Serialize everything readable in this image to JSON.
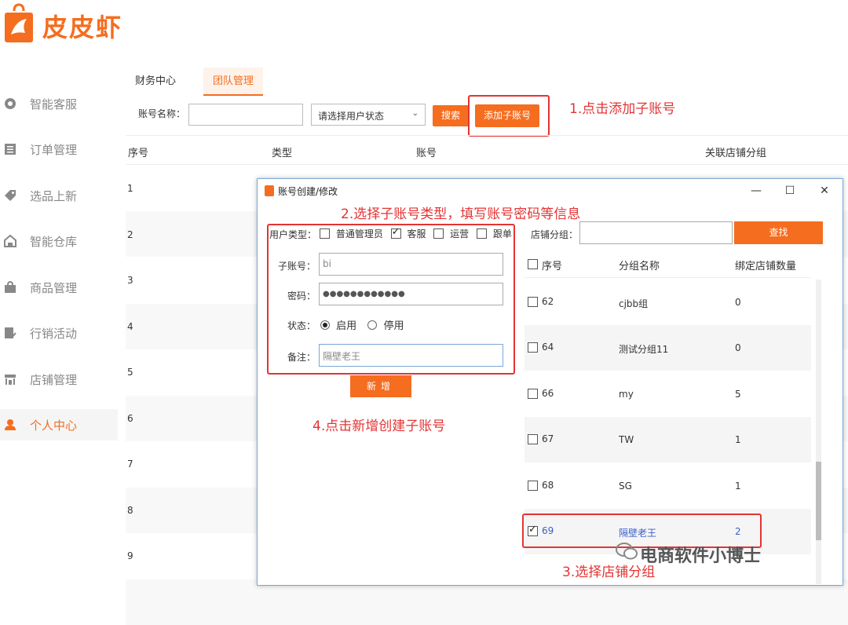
{
  "brand": {
    "name": "皮皮虾"
  },
  "sidebar": {
    "items": [
      {
        "label": "智能客服",
        "icon": "chat-icon"
      },
      {
        "label": "订单管理",
        "icon": "list-icon"
      },
      {
        "label": "选品上新",
        "icon": "tag-icon"
      },
      {
        "label": "智能仓库",
        "icon": "warehouse-icon"
      },
      {
        "label": "商品管理",
        "icon": "bag-icon"
      },
      {
        "label": "行销活动",
        "icon": "campaign-icon"
      },
      {
        "label": "店铺管理",
        "icon": "store-icon"
      },
      {
        "label": "个人中心",
        "icon": "user-icon"
      }
    ],
    "active_index": 7
  },
  "tabs": [
    {
      "label": "财务中心"
    },
    {
      "label": "团队管理"
    }
  ],
  "filter": {
    "account_label": "账号名称：",
    "status_placeholder": "请选择用户状态",
    "search_label": "搜索",
    "add_label": "添加子账号"
  },
  "table": {
    "headers": {
      "no": "序号",
      "type": "类型",
      "account": "账号",
      "group": "关联店铺分组"
    },
    "rows": [
      "1",
      "2",
      "3",
      "4",
      "5",
      "6",
      "7",
      "8",
      "9"
    ]
  },
  "annotations": {
    "step1": "1.点击添加子账号",
    "step2": "2.选择子账号类型，填写账号密码等信息",
    "step3": "3.选择店铺分组",
    "step4": "4.点击新增创建子账号"
  },
  "dialog": {
    "title": "账号创建/修改",
    "controls": {
      "minimize": "—",
      "maximize": "☐",
      "close": "✕"
    },
    "user_type_label": "用户类型：",
    "user_types": [
      {
        "label": "普通管理员",
        "checked": false
      },
      {
        "label": "客服",
        "checked": true
      },
      {
        "label": "运营",
        "checked": false
      },
      {
        "label": "跟单",
        "checked": false
      }
    ],
    "sub_account_label": "子账号：",
    "sub_account_value": "bi",
    "password_label": "密码：",
    "password_value": "●●●●●●●●●●●●",
    "status_label": "状态：",
    "status_enabled": "启用",
    "status_disabled": "停用",
    "status_selected": "启用",
    "note_label": "备注：",
    "note_value": "隔壁老王",
    "new_button": "新增",
    "group_label": "店铺分组：",
    "find_button": "查找",
    "group_headers": {
      "no": "序号",
      "name": "分组名称",
      "count": "绑定店铺数量"
    },
    "groups": [
      {
        "no": "62",
        "name": "cjbb组",
        "count": "0",
        "checked": false
      },
      {
        "no": "64",
        "name": "测试分组11",
        "count": "0",
        "checked": false
      },
      {
        "no": "66",
        "name": "my",
        "count": "5",
        "checked": false
      },
      {
        "no": "67",
        "name": "TW",
        "count": "1",
        "checked": false
      },
      {
        "no": "68",
        "name": "SG",
        "count": "1",
        "checked": false
      },
      {
        "no": "69",
        "name": "隔壁老王",
        "count": "2",
        "checked": true
      }
    ]
  },
  "watermark": "电商软件小博士",
  "colors": {
    "accent": "#f56d1f",
    "annotation": "#e53333",
    "selected_text": "#3a5fc8"
  }
}
